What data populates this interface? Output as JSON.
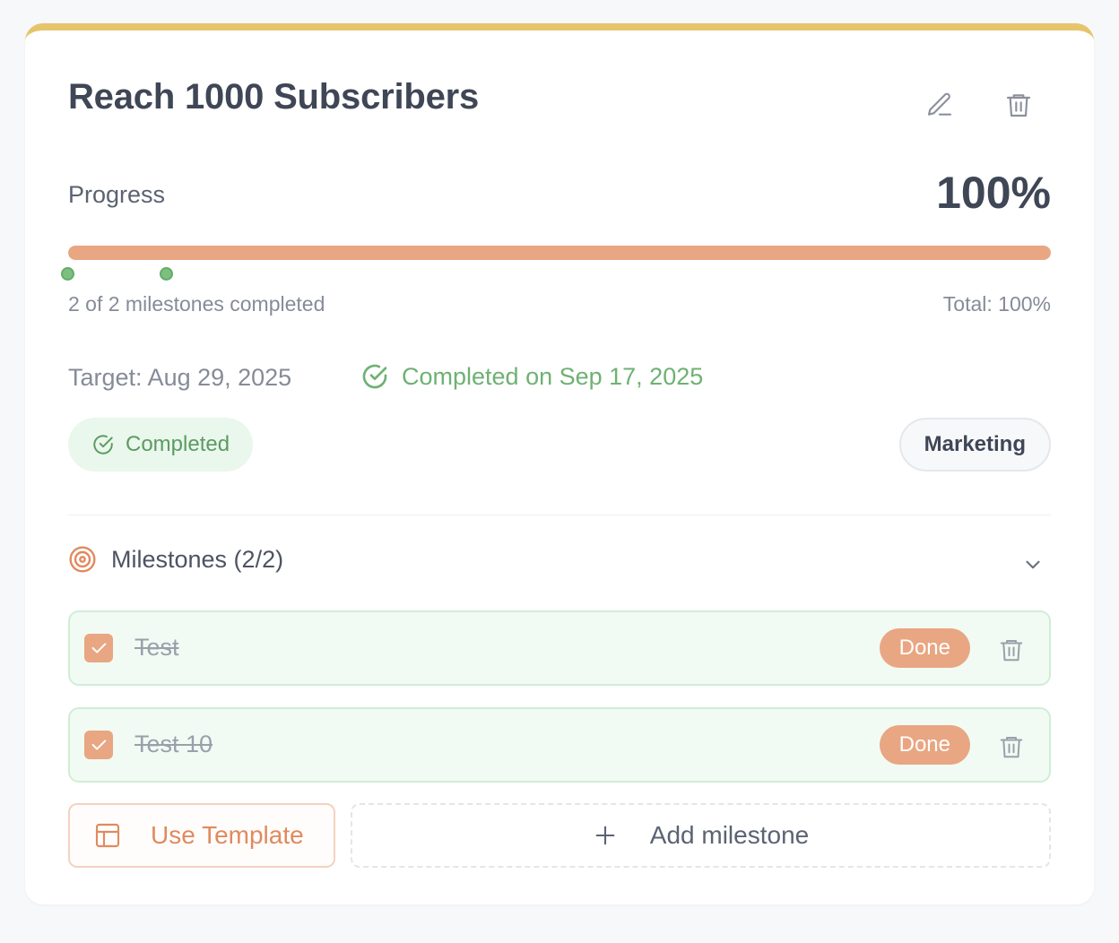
{
  "goal": {
    "title": "Reach 1000 Subscribers",
    "accent_color": "#e6c46a"
  },
  "actions": {
    "edit_icon": "pencil-icon",
    "delete_icon": "trash-icon"
  },
  "progress": {
    "label": "Progress",
    "percent_text": "100%",
    "value_fraction": 1.0,
    "milestone_markers": 2,
    "milestones_summary": "2 of 2 milestones completed",
    "total_text": "Total: 100%",
    "bar_color": "#e9a682"
  },
  "dates": {
    "target": "Target: Aug 29, 2025",
    "completed_on": "Completed on Sep 17, 2025"
  },
  "status": {
    "label": "Completed",
    "color": "#5c9b62"
  },
  "category": {
    "label": "Marketing"
  },
  "milestones": {
    "header": "Milestones (2/2)",
    "items": [
      {
        "name": "Test",
        "done_label": "Done",
        "checked": true
      },
      {
        "name": "Test 10",
        "done_label": "Done",
        "checked": true
      }
    ]
  },
  "footer": {
    "use_template_label": "Use Template",
    "add_milestone_label": "Add milestone",
    "add_icon": "plus-icon",
    "template_icon": "layout-template-icon"
  }
}
